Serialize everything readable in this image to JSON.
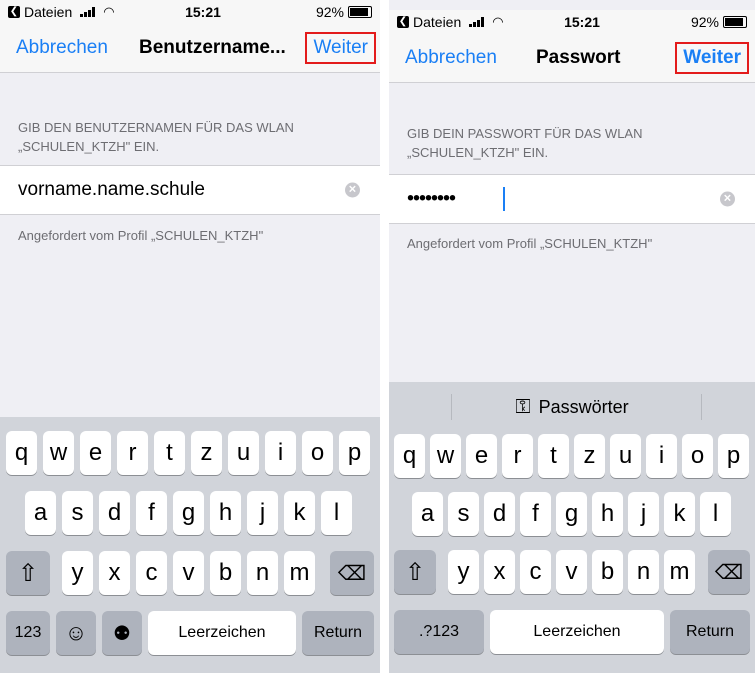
{
  "colors": {
    "accent": "#1a7ff5",
    "highlight_box": "#e31b1b"
  },
  "screens": [
    {
      "status": {
        "back_label": "Dateien",
        "time": "15:21",
        "battery": "92%",
        "battery_level": 0.92
      },
      "nav": {
        "cancel": "Abbrechen",
        "title": "Benutzername...",
        "next": "Weiter"
      },
      "field_header": "GIB DEN BENUTZERNAMEN FÜR DAS WLAN „SCHULEN_KTZH\" EIN.",
      "field_value": "vorname.name.schule",
      "field_footer": "Angefordert vom Profil „SCHULEN_KTZH\"",
      "keyboard": {
        "row1": [
          "q",
          "w",
          "e",
          "r",
          "t",
          "z",
          "u",
          "i",
          "o",
          "p"
        ],
        "row2": [
          "a",
          "s",
          "d",
          "f",
          "g",
          "h",
          "j",
          "k",
          "l"
        ],
        "row3": [
          "y",
          "x",
          "c",
          "v",
          "b",
          "n",
          "m"
        ],
        "numbers": "123",
        "space": "Leerzeichen",
        "return": "Return",
        "icons": {
          "shift": "shift-icon",
          "delete": "delete-icon",
          "emoji": "emoji-icon",
          "mic": "microphone-icon"
        }
      }
    },
    {
      "status": {
        "back_label": "Dateien",
        "time": "15:21",
        "battery": "92%",
        "battery_level": 0.92
      },
      "nav": {
        "cancel": "Abbrechen",
        "title": "Passwort",
        "next": "Weiter"
      },
      "field_header": "GIB DEIN PASSWORT FÜR DAS WLAN „SCHULEN_KTZH\" EIN.",
      "field_value": "••••••••",
      "field_footer": "Angefordert vom Profil „SCHULEN_KTZH\"",
      "keyboard": {
        "suggestion": "Passwörter",
        "row1": [
          "q",
          "w",
          "e",
          "r",
          "t",
          "z",
          "u",
          "i",
          "o",
          "p"
        ],
        "row2": [
          "a",
          "s",
          "d",
          "f",
          "g",
          "h",
          "j",
          "k",
          "l"
        ],
        "row3": [
          "y",
          "x",
          "c",
          "v",
          "b",
          "n",
          "m"
        ],
        "numbers": ".?123",
        "space": "Leerzeichen",
        "return": "Return",
        "icons": {
          "shift": "shift-icon",
          "delete": "delete-icon",
          "key": "key-icon"
        }
      }
    }
  ]
}
